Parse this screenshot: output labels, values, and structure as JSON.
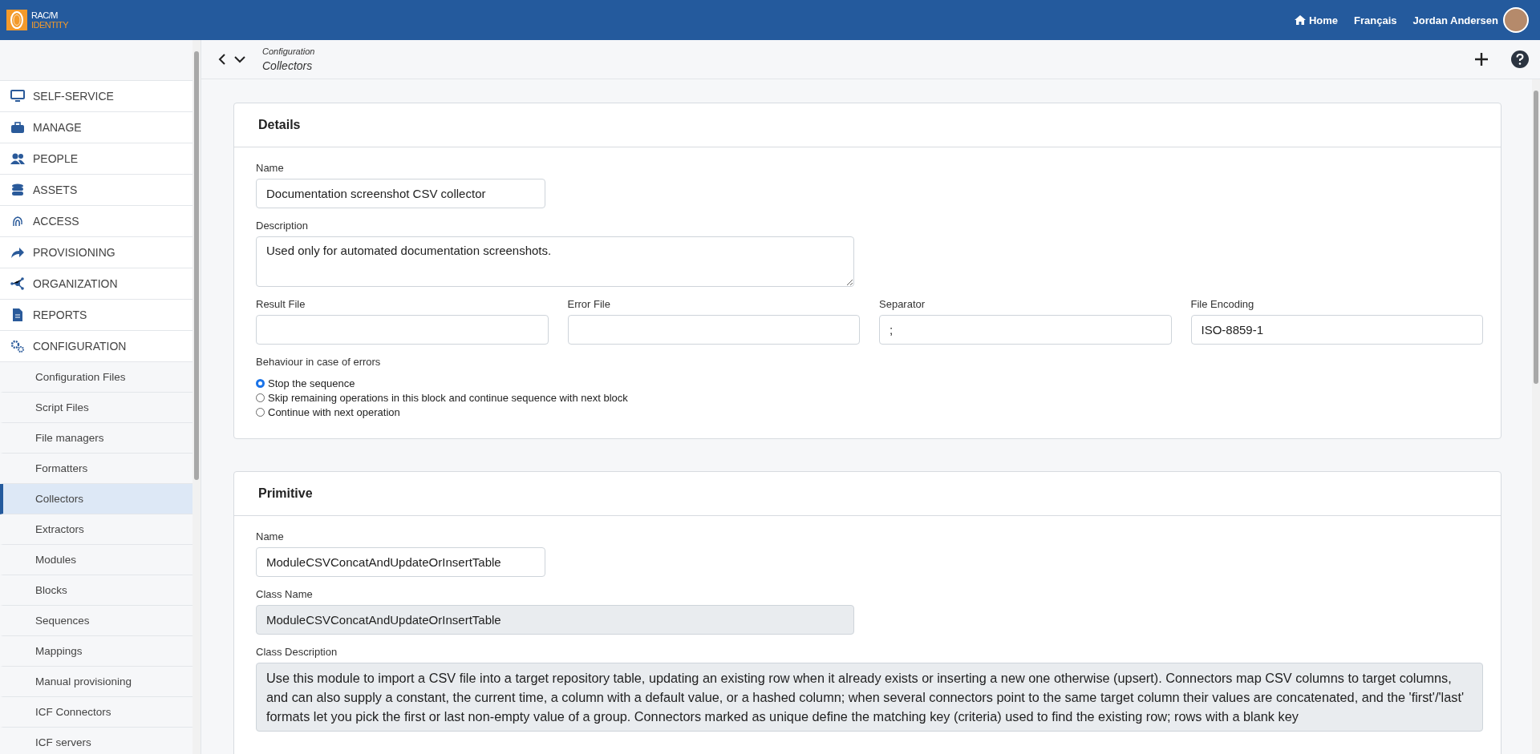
{
  "header": {
    "logo_top": "RAC/M",
    "logo_bottom": "IDENTITY",
    "nav": [
      {
        "kind": "home",
        "label": "Home"
      },
      {
        "kind": "plain",
        "label": "Français"
      }
    ],
    "user": {
      "name": "Jordan Andersen"
    }
  },
  "breadcrumb": {
    "parent": "Configuration",
    "current": "Collectors"
  },
  "sidebar": {
    "items": [
      {
        "label": "SELF-SERVICE"
      },
      {
        "label": "MANAGE"
      },
      {
        "label": "PEOPLE"
      },
      {
        "label": "ASSETS"
      },
      {
        "label": "ACCESS"
      },
      {
        "label": "PROVISIONING"
      },
      {
        "label": "ORGANIZATION"
      },
      {
        "label": "REPORTS"
      },
      {
        "label": "CONFIGURATION",
        "children": [
          {
            "label": "Configuration Files",
            "selected": false
          },
          {
            "label": "Script Files",
            "selected": false
          },
          {
            "label": "File managers",
            "selected": false
          },
          {
            "label": "Formatters",
            "selected": false
          },
          {
            "label": "Collectors",
            "selected": true
          },
          {
            "label": "Extractors",
            "selected": false
          },
          {
            "label": "Modules",
            "selected": false
          },
          {
            "label": "Blocks",
            "selected": false
          },
          {
            "label": "Sequences",
            "selected": false
          },
          {
            "label": "Mappings",
            "selected": false
          },
          {
            "label": "Manual provisioning",
            "selected": false
          },
          {
            "label": "ICF Connectors",
            "selected": false
          },
          {
            "label": "ICF servers",
            "selected": false
          }
        ]
      }
    ]
  },
  "details": {
    "title": "Details",
    "name": {
      "label": "Name",
      "value": "Documentation screenshot CSV collector"
    },
    "description": {
      "label": "Description",
      "value": "Used only for automated documentation screenshots."
    },
    "files": [
      {
        "label": "Result File"
      },
      {
        "label": "Error File"
      },
      {
        "label": "Separator",
        "value": ";"
      },
      {
        "label": "File Encoding",
        "value": "ISO-8859-1"
      }
    ],
    "behaviour": {
      "label": "Behaviour in case of errors",
      "options": [
        {
          "label": "Stop the sequence",
          "selected": true
        },
        {
          "label": "Skip remaining operations in this block and continue sequence with next block",
          "selected": false
        },
        {
          "label": "Continue with next operation",
          "selected": false
        }
      ]
    }
  },
  "primitive": {
    "title": "Primitive",
    "name": {
      "label": "Name",
      "value": "ModuleCSVConcatAndUpdateOrInsertTable",
      "disabled": false
    },
    "class_name": {
      "label": "Class Name",
      "value": "ModuleCSVConcatAndUpdateOrInsertTable",
      "disabled": true
    },
    "class_description": {
      "label": "Class Description",
      "value": "Use this module to import a CSV file into a target repository table, updating an existing row when it already exists or inserting a new one otherwise (upsert). Connectors map CSV columns to target columns, and can also supply a constant, the current time, a column with a default value, or a hashed column; when several connectors point to the same target column their values are concatenated, and the 'first'/'last' formats let you pick the first or last non-empty value of a group. Connectors marked as unique define the matching key (criteria) used to find the existing row; rows with a blank key",
      "disabled": true
    }
  }
}
